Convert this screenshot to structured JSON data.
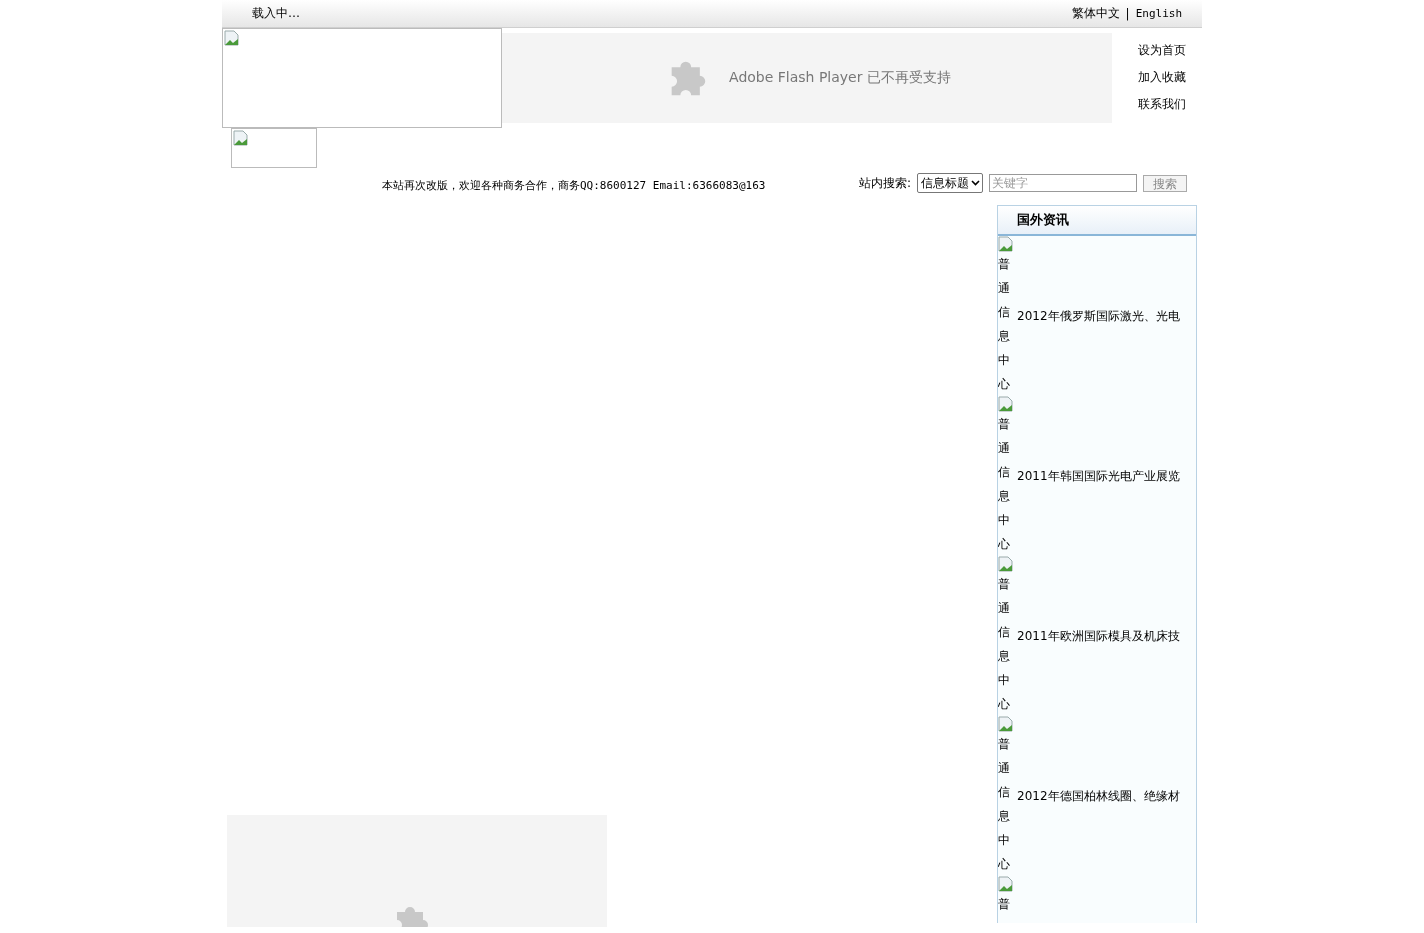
{
  "top_bar": {
    "loading": "载入中…",
    "languages": [
      {
        "label": "繁体中文"
      },
      {
        "label": "English"
      }
    ],
    "separator": "|"
  },
  "flash_banner": {
    "message": "Adobe Flash Player 已不再受支持"
  },
  "header_links": [
    "设为首页",
    "加入收藏",
    "联系我们"
  ],
  "notice": "本站再次改版，欢迎各种商务合作，商务QQ:8600127 Email:6366083@163",
  "search": {
    "label": "站内搜索:",
    "select_value": "信息标题",
    "placeholder": "关键字",
    "button": "搜索"
  },
  "sidebar": {
    "title": "国外资讯",
    "items": [
      {
        "alt": "普通信息中心",
        "title": "2012年俄罗斯国际激光、光电"
      },
      {
        "alt": "普通信息中心",
        "title": "2011年韩国国际光电产业展览"
      },
      {
        "alt": "普通信息中心",
        "title": "2011年欧洲国际模具及机床技"
      },
      {
        "alt": "普通信息中心",
        "title": "2012年德国柏林线圈、绝缘材"
      },
      {
        "alt": "普"
      }
    ]
  }
}
